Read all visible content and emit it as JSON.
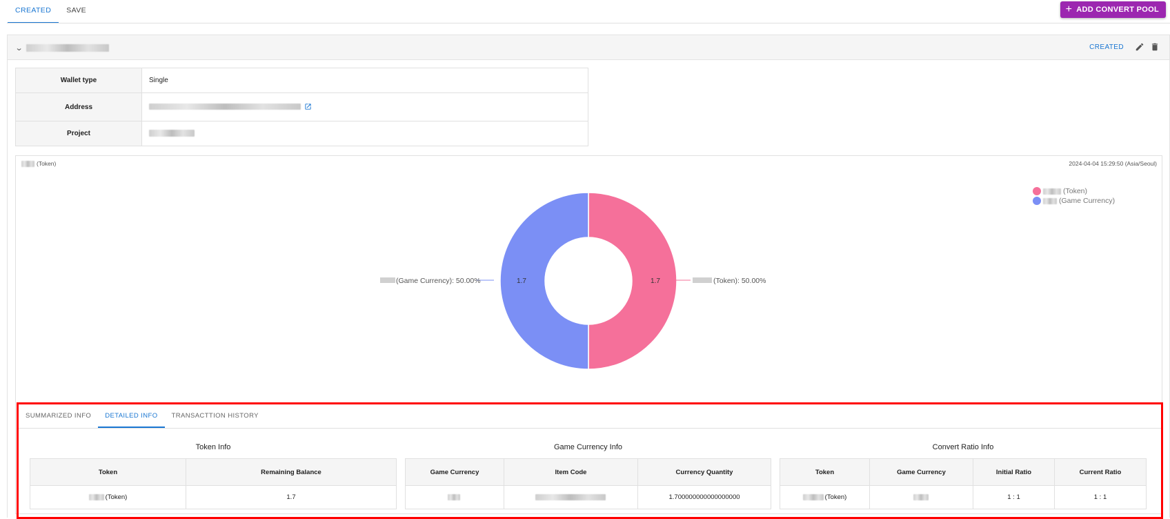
{
  "top_tabs": [
    {
      "label": "CREATED",
      "active": true
    },
    {
      "label": "SAVE",
      "active": false
    }
  ],
  "add_button": {
    "label": "ADD CONVERT POOL",
    "icon": "plus-icon",
    "color": "#9c27b0"
  },
  "pool": {
    "status": "CREATED",
    "icons": [
      "chevron-down-icon",
      "edit-icon",
      "delete-icon"
    ],
    "info": {
      "wallet_type_label": "Wallet type",
      "wallet_type_value": "Single",
      "address_label": "Address",
      "project_label": "Project"
    }
  },
  "chart": {
    "title_suffix": "(Token)",
    "timestamp": "2024-04-04 15:29:50 (Asia/Seoul)",
    "legend": [
      {
        "label": "(Token)",
        "color": "#f5709a"
      },
      {
        "label": "(Game Currency)",
        "color": "#7b8ff5"
      }
    ],
    "callouts": {
      "left": "(Game Currency): 50.00%",
      "right": "(Token): 50.00%"
    },
    "slice_labels": {
      "left": "1.7",
      "right": "1.7"
    }
  },
  "chart_data": {
    "type": "pie",
    "donut": true,
    "categories": [
      "(Token)",
      "(Game Currency)"
    ],
    "values": [
      1.7,
      1.7
    ],
    "percentages": [
      50.0,
      50.0
    ],
    "colors": [
      "#f5709a",
      "#7b8ff5"
    ],
    "legend_placement": "top-right"
  },
  "detail_tabs": [
    {
      "label": "SUMMARIZED INFO",
      "active": false
    },
    {
      "label": "DETAILED INFO",
      "active": true
    },
    {
      "label": "TRANSACTTION HISTORY",
      "active": false
    }
  ],
  "token_info": {
    "title": "Token Info",
    "headers": [
      "Token",
      "Remaining Balance"
    ],
    "row": {
      "token_suffix": "(Token)",
      "balance": "1.7"
    }
  },
  "game_currency_info": {
    "title": "Game Currency Info",
    "headers": [
      "Game Currency",
      "Item Code",
      "Currency Quantity"
    ],
    "row": {
      "quantity": "1.700000000000000000"
    }
  },
  "convert_ratio_info": {
    "title": "Convert Ratio Info",
    "headers": [
      "Token",
      "Game Currency",
      "Initial Ratio",
      "Current Ratio"
    ],
    "row": {
      "token_suffix": "(Token)",
      "initial_ratio": "1 : 1",
      "current_ratio": "1 : 1"
    }
  }
}
